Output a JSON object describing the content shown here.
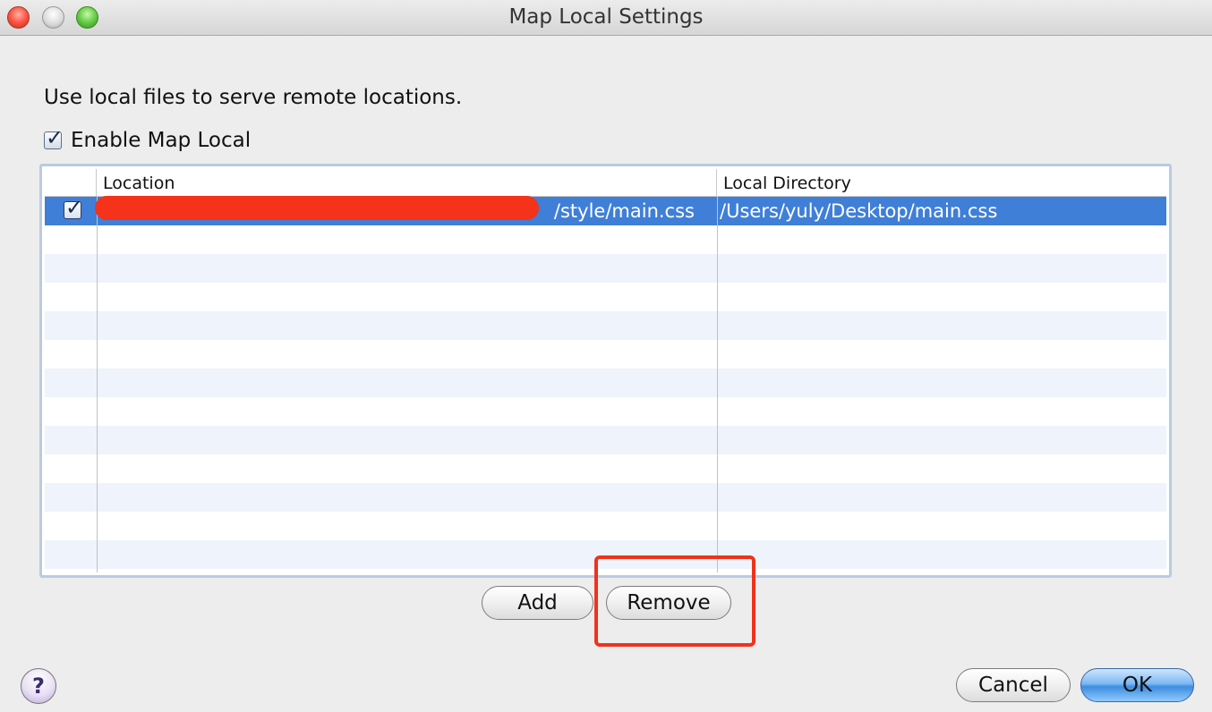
{
  "window": {
    "title": "Map Local Settings"
  },
  "intro_text": "Use local files to serve remote locations.",
  "enable": {
    "label": "Enable Map Local",
    "checked": true
  },
  "table": {
    "columns": [
      "",
      "Location",
      "Local Directory"
    ],
    "rows": [
      {
        "enabled": true,
        "location_visible": "/style/main.css",
        "local_directory": "/Users/yuly/Desktop/main.css",
        "selected": true
      }
    ]
  },
  "buttons": {
    "add": "Add",
    "remove": "Remove",
    "cancel": "Cancel",
    "ok": "OK",
    "help": "?"
  },
  "icons": {
    "close": "close-traffic-light-icon",
    "minimize": "minimize-traffic-light-icon",
    "zoom": "zoom-traffic-light-icon",
    "check": "checkmark-icon",
    "help": "help-icon"
  },
  "colors": {
    "selection": "#3f7fd8",
    "highlight": "#f0321c",
    "redaction": "#f5321a",
    "ok_accent": "#3e8ddf"
  }
}
